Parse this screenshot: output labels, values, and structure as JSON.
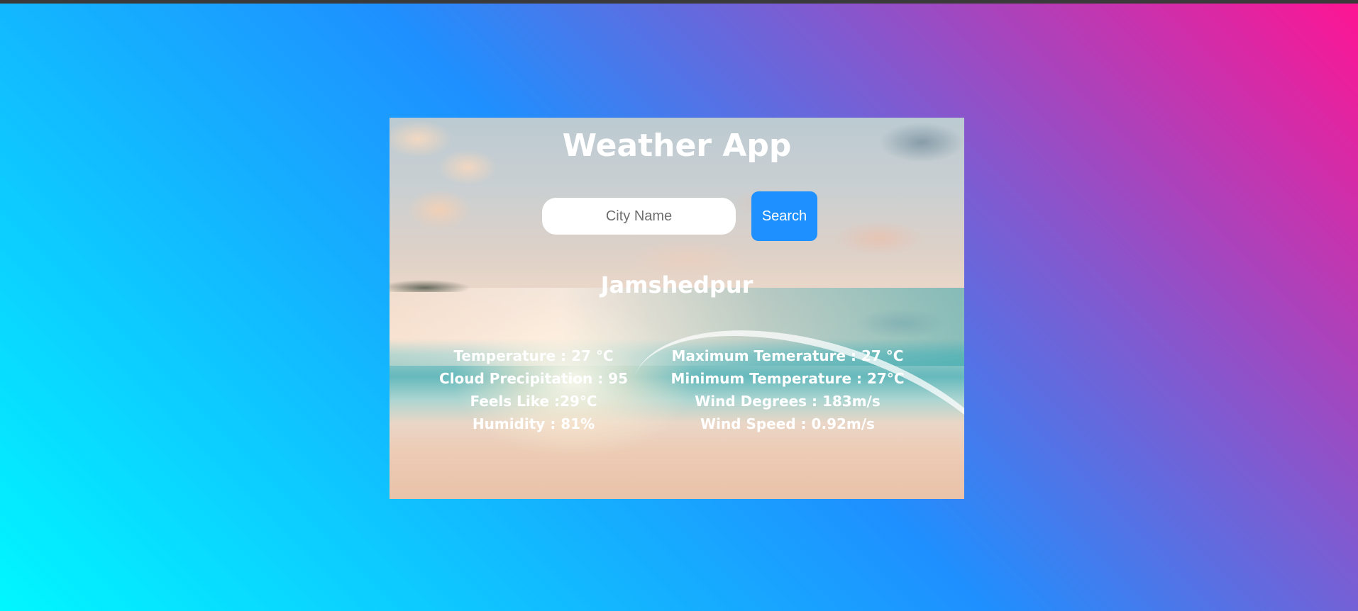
{
  "app": {
    "title": "Weather App"
  },
  "search": {
    "placeholder": "City Name",
    "value": "",
    "button_label": "Search"
  },
  "weather": {
    "city": "Jamshedpur",
    "left_stats": [
      "Temperature : 27 °C",
      "Cloud Precipitation : 95",
      "Feels Like :29°C",
      "Humidity : 81%"
    ],
    "right_stats": [
      "Maximum Temerature : 27 °C",
      "Minimum Temperature : 27°C",
      "Wind Degrees : 183m/s",
      "Wind Speed : 0.92m/s"
    ]
  },
  "colors": {
    "background_gradient": [
      "#00f7ff",
      "#1e90ff",
      "#ff1493"
    ],
    "button": "#1e90ff",
    "text": "#ffffff"
  }
}
